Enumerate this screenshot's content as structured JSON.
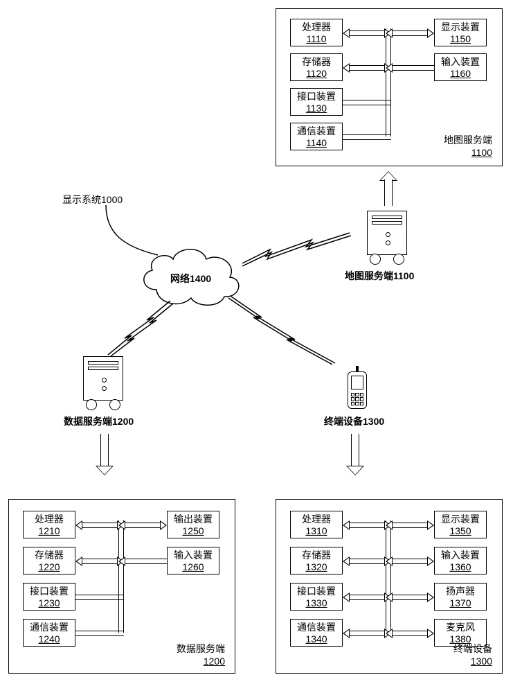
{
  "system": {
    "label": "显示系统1000"
  },
  "network": {
    "label": "网络1400"
  },
  "mapServer": {
    "iconLabel": "地图服务端1100",
    "panel": {
      "title": "地图服务端",
      "num": "1100",
      "left": [
        {
          "label": "处理器",
          "num": "1110"
        },
        {
          "label": "存储器",
          "num": "1120"
        },
        {
          "label": "接口装置",
          "num": "1130"
        },
        {
          "label": "通信装置",
          "num": "1140"
        }
      ],
      "right": [
        {
          "label": "显示装置",
          "num": "1150"
        },
        {
          "label": "输入装置",
          "num": "1160"
        }
      ]
    }
  },
  "dataServer": {
    "iconLabel": "数据服务端1200",
    "panel": {
      "title": "数据服务端",
      "num": "1200",
      "left": [
        {
          "label": "处理器",
          "num": "1210"
        },
        {
          "label": "存储器",
          "num": "1220"
        },
        {
          "label": "接口装置",
          "num": "1230"
        },
        {
          "label": "通信装置",
          "num": "1240"
        }
      ],
      "right": [
        {
          "label": "输出装置",
          "num": "1250"
        },
        {
          "label": "输入装置",
          "num": "1260"
        }
      ]
    }
  },
  "terminal": {
    "iconLabel": "终端设备1300",
    "panel": {
      "title": "终端设备",
      "num": "1300",
      "left": [
        {
          "label": "处理器",
          "num": "1310"
        },
        {
          "label": "存储器",
          "num": "1320"
        },
        {
          "label": "接口装置",
          "num": "1330"
        },
        {
          "label": "通信装置",
          "num": "1340"
        }
      ],
      "right": [
        {
          "label": "显示装置",
          "num": "1350"
        },
        {
          "label": "输入装置",
          "num": "1360"
        },
        {
          "label": "扬声器",
          "num": "1370"
        },
        {
          "label": "麦克风",
          "num": "1380"
        }
      ]
    }
  }
}
